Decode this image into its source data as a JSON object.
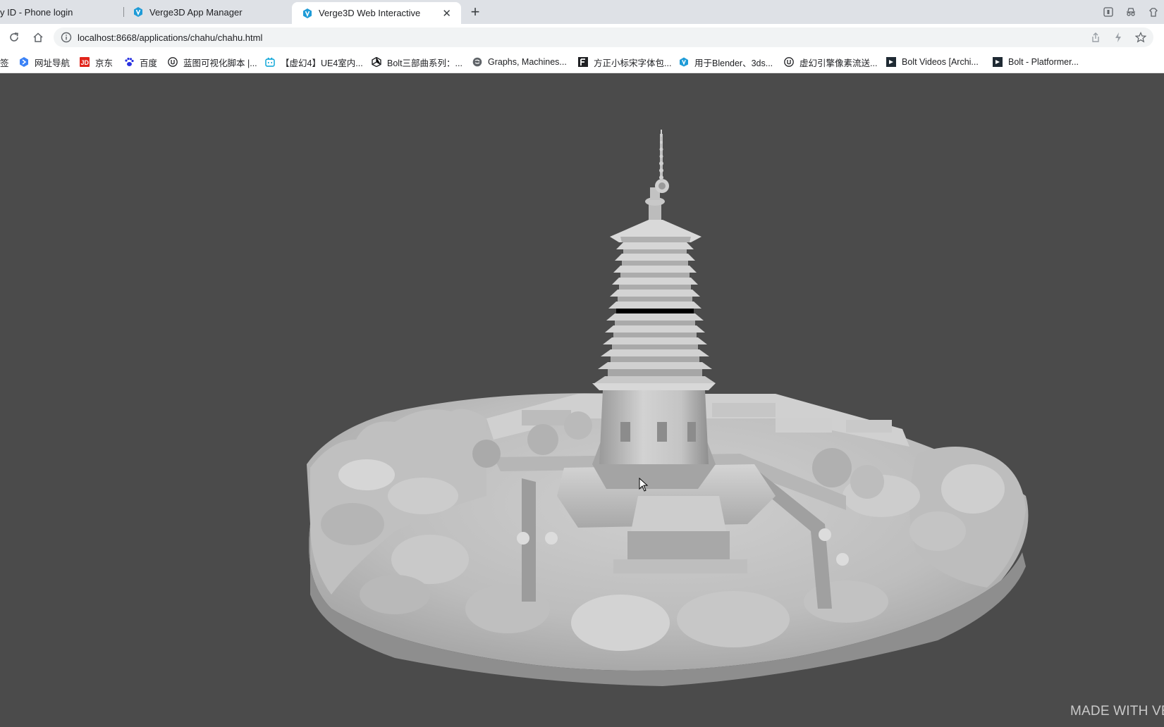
{
  "tabs": [
    {
      "title": "y ID - Phone login",
      "active": false
    },
    {
      "title": "Verge3D App Manager",
      "active": false
    },
    {
      "title": "Verge3D Web Interactive",
      "active": true
    }
  ],
  "address_bar": {
    "url": "localhost:8668/applications/chahu/chahu.html"
  },
  "bookmarks": [
    {
      "label": "签",
      "icon": "folder-icon"
    },
    {
      "label": "网址导航",
      "icon": "navigation-icon"
    },
    {
      "label": "京东",
      "icon": "jd-icon"
    },
    {
      "label": "百度",
      "icon": "baidu-paw-icon"
    },
    {
      "label": "蓝图可视化脚本 |...",
      "icon": "unreal-icon"
    },
    {
      "label": "【虚幻4】UE4室内...",
      "icon": "bilibili-icon"
    },
    {
      "label": "Bolt三部曲系列：...",
      "icon": "unity-icon"
    },
    {
      "label": "Graphs, Machines...",
      "icon": "graphs-icon"
    },
    {
      "label": "方正小标宋字体包...",
      "icon": "f-icon"
    },
    {
      "label": "用于Blender、3ds...",
      "icon": "verge3d-icon"
    },
    {
      "label": "虚幻引擎像素流送...",
      "icon": "unreal-icon"
    },
    {
      "label": "Bolt Videos [Archi...",
      "icon": "bolt-icon"
    },
    {
      "label": "Bolt - Platformer...",
      "icon": "bolt-icon"
    }
  ],
  "viewport": {
    "watermark": "MADE WITH VE",
    "background_color": "#4b4b4b",
    "model_color": "#c8c8c8"
  },
  "colors": {
    "tab_strip": "#dee1e6",
    "verge3d_brand": "#1e9bd7"
  }
}
